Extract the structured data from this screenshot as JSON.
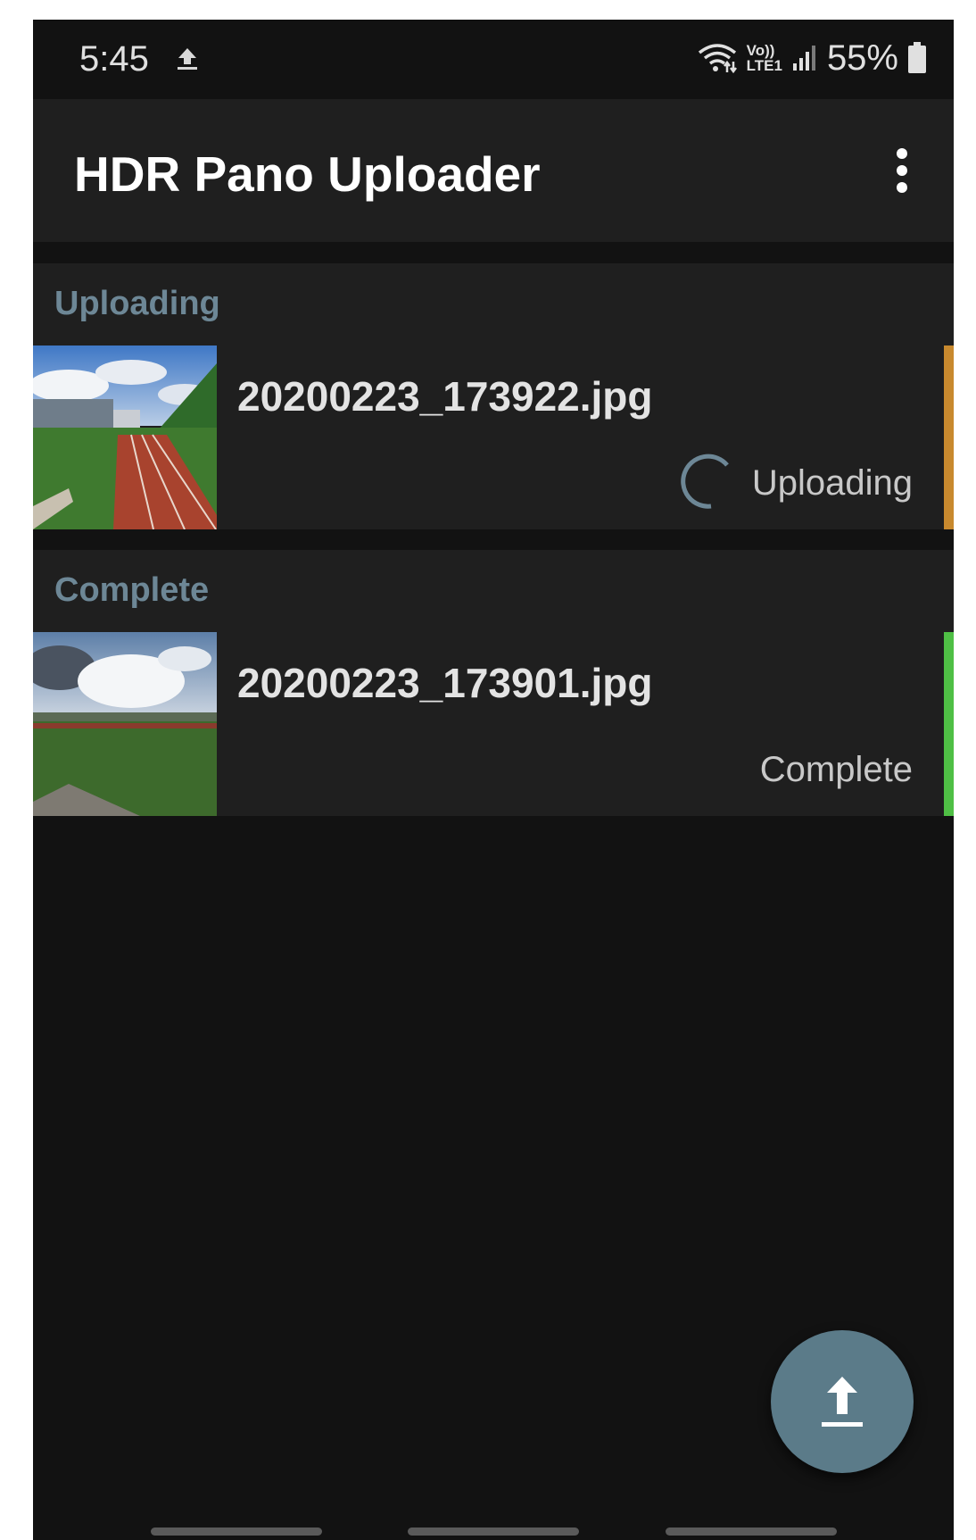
{
  "status_bar": {
    "time": "5:45",
    "upload_icon": "upload-arrow-icon",
    "wifi_icon": "wifi-icon",
    "volte_label": "Vo))",
    "lte_label": "LTE1",
    "signal_icon": "signal-bars-icon",
    "battery_percent": "55%",
    "battery_icon": "battery-icon"
  },
  "app_bar": {
    "title": "HDR Pano Uploader",
    "menu_icon": "more-vert-icon"
  },
  "sections": [
    {
      "header": "Uploading",
      "items": [
        {
          "file_name": "20200223_173922.jpg",
          "status": "Uploading",
          "status_color": "#c8892e"
        }
      ]
    },
    {
      "header": "Complete",
      "items": [
        {
          "file_name": "20200223_173901.jpg",
          "status": "Complete",
          "status_color": "#4fbf45"
        }
      ]
    }
  ],
  "fab": {
    "icon": "upload-icon"
  },
  "colors": {
    "background": "#121212",
    "surface": "#1f1f1f",
    "section_header": "#6d8796",
    "fab": "#5b7b89"
  }
}
